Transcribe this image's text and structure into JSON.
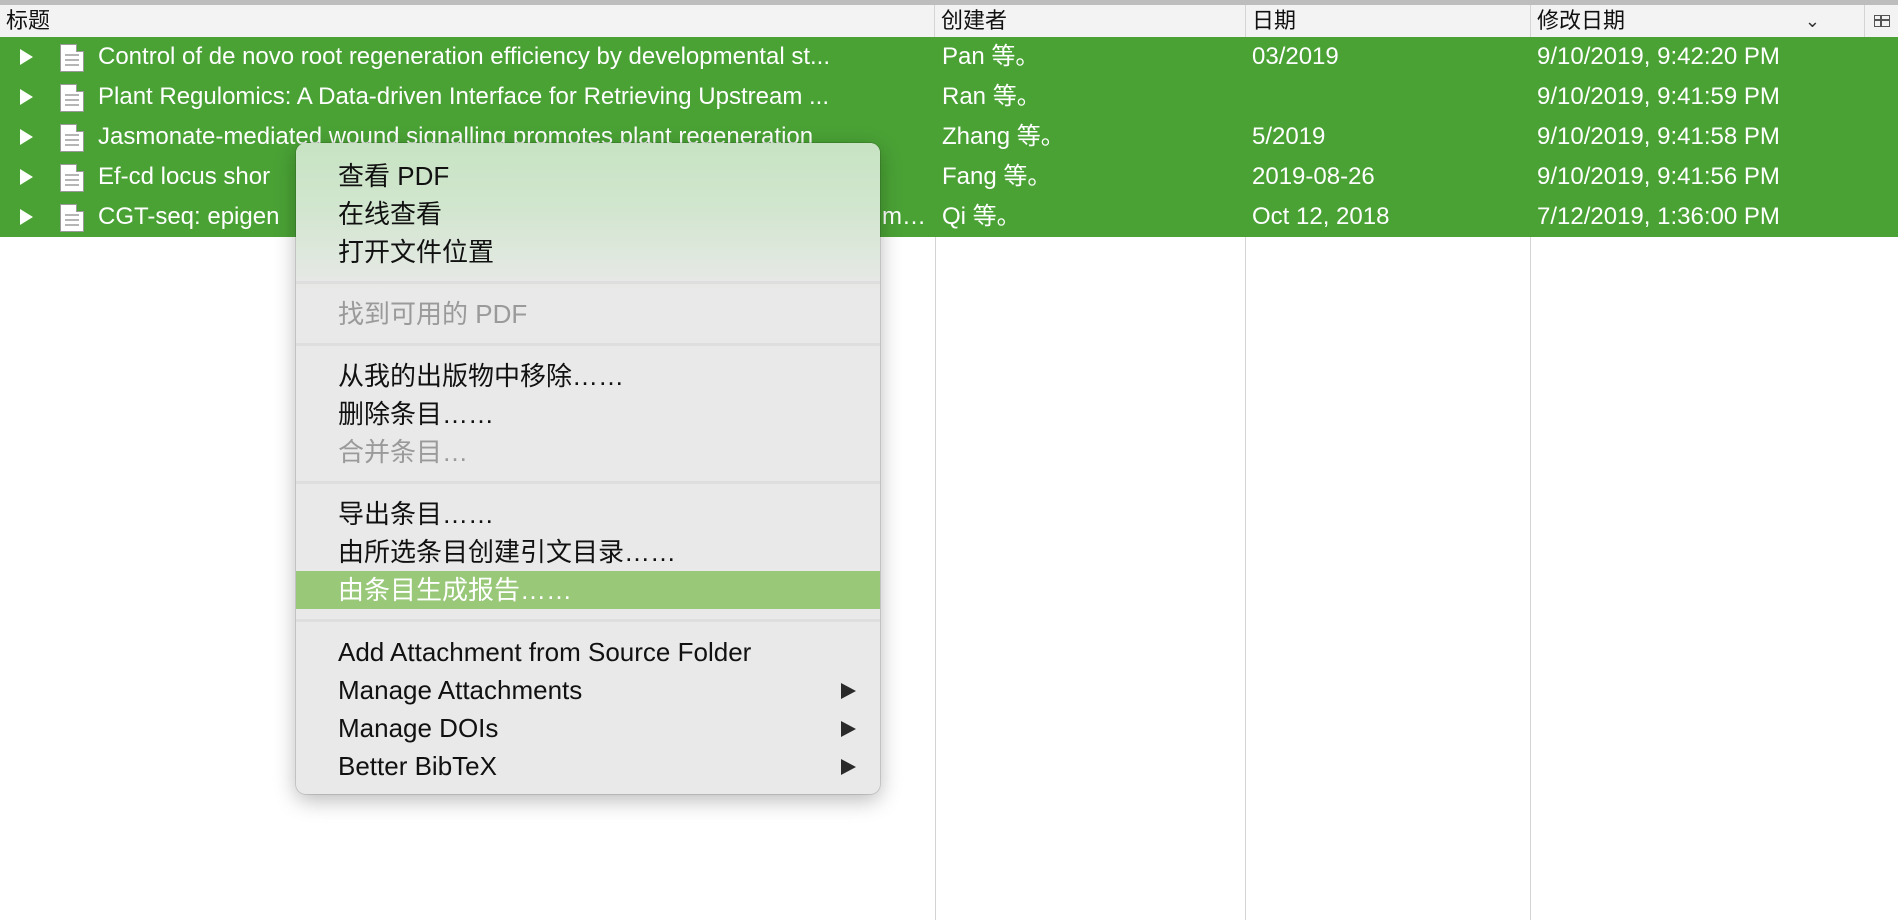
{
  "columns": {
    "title": "标题",
    "creator": "创建者",
    "date": "日期",
    "modified": "修改日期"
  },
  "icons": {
    "sort": "chevron-down-icon",
    "column_picker": "column-picker-icon",
    "row_toggle": "disclosure-triangle-icon",
    "item_type": "document-icon",
    "submenu": "submenu-arrow-icon"
  },
  "colors": {
    "selection": "#4aa235",
    "menu_highlight": "#98c878"
  },
  "rows": [
    {
      "title": "Control of de novo root regeneration efficiency by developmental st...",
      "creator": "Pan 等。",
      "date": "03/2019",
      "modified": "9/10/2019, 9:42:20 PM"
    },
    {
      "title": "Plant Regulomics: A Data-driven Interface for Retrieving Upstream ...",
      "creator": "Ran 等。",
      "date": "",
      "modified": "9/10/2019, 9:41:59 PM"
    },
    {
      "title": "Jasmonate-mediated wound signalling promotes plant regeneration",
      "creator": "Zhang 等。",
      "date": "5/2019",
      "modified": "9/10/2019, 9:41:58 PM"
    },
    {
      "title": "Ef-cd locus shor",
      "creator": "Fang 等。",
      "date": "2019-08-26",
      "modified": "9/10/2019, 9:41:56 PM"
    },
    {
      "title": "CGT-seq: epigen",
      "title_tail": "me...",
      "creator": "Qi 等。",
      "date": "Oct 12, 2018",
      "modified": "7/12/2019, 1:36:00 PM"
    }
  ],
  "menu": {
    "items": [
      {
        "label": "查看 PDF",
        "disabled": false
      },
      {
        "label": "在线查看",
        "disabled": false
      },
      {
        "label": "打开文件位置",
        "disabled": false
      },
      {
        "label": "找到可用的 PDF",
        "disabled": true
      },
      {
        "label": "从我的出版物中移除……",
        "disabled": false
      },
      {
        "label": "删除条目……",
        "disabled": false
      },
      {
        "label": "合并条目…",
        "disabled": true
      },
      {
        "label": "导出条目……",
        "disabled": false
      },
      {
        "label": "由所选条目创建引文目录……",
        "disabled": false
      },
      {
        "label": "由条目生成报告……",
        "disabled": false,
        "highlighted": true
      },
      {
        "label": "Add Attachment from Source Folder",
        "disabled": false
      },
      {
        "label": "Manage Attachments",
        "disabled": false,
        "submenu": true
      },
      {
        "label": "Manage DOIs",
        "disabled": false,
        "submenu": true
      },
      {
        "label": "Better BibTeX",
        "disabled": false,
        "submenu": true
      }
    ]
  }
}
